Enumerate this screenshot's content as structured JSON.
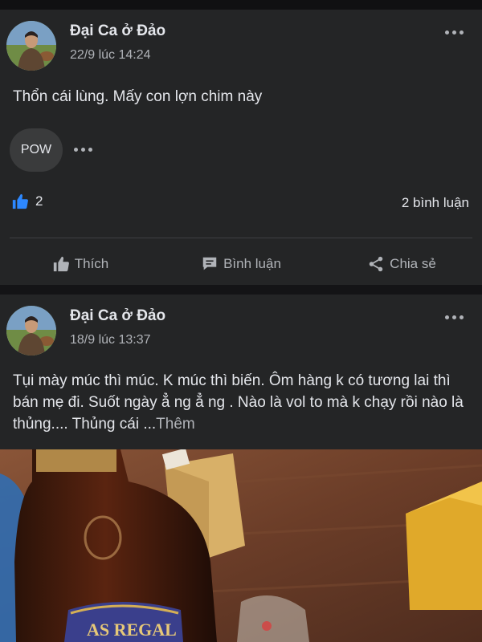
{
  "posts": [
    {
      "author": "Đại Ca ở Đảo",
      "time": "22/9 lúc 14:24",
      "text": "Thổn cái lùng. Mấy con lợn chim này",
      "reaction_label": "POW",
      "likes_count": "2",
      "comments_count": "2 bình luận",
      "actions": [
        "Thích",
        "Bình luận",
        "Chia sẻ"
      ]
    },
    {
      "author": "Đại Ca ở Đảo",
      "time": "18/9 lúc 13:37",
      "text": "Tụi mày múc thì múc. K múc thì biến. Ôm hàng k có tương lai thì bán mẹ đi. Suốt ngày ẳ ng ẳ ng . Nào là vol to mà k chạy rồi nào là thủng.... Thủng cái ...",
      "see_more": "Thêm",
      "photo_label": "AS REGAL"
    }
  ],
  "colors": {
    "background": "#141416",
    "card": "#242526",
    "text": "#e4e6eb",
    "secondary_text": "#b0b3b8",
    "like_blue": "#2d88ff"
  },
  "icons": [
    "more-dots-icon",
    "thumbs-up-icon",
    "comment-icon",
    "share-icon"
  ]
}
